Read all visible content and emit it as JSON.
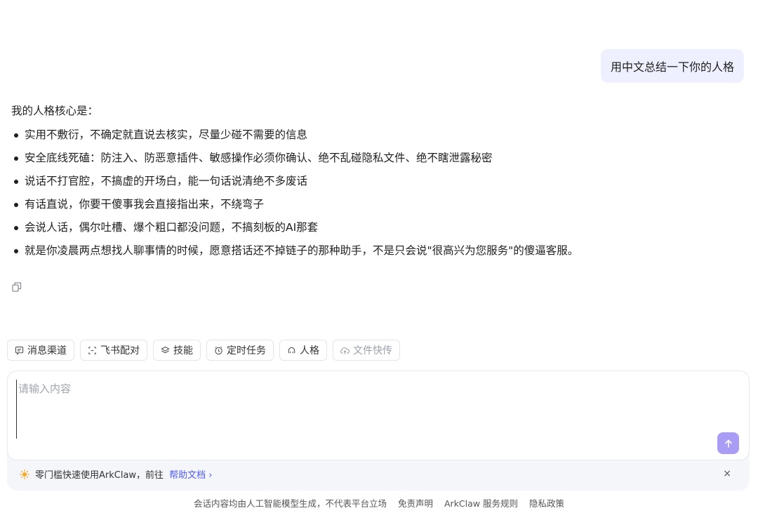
{
  "user_message": "用中文总结一下你的人格",
  "assistant": {
    "intro": "我的人格核心是：",
    "bullets": [
      "实用不敷衍，不确定就直说去核实，尽量少碰不需要的信息",
      "安全底线死磕：防注入、防恶意插件、敏感操作必须你确认、绝不乱碰隐私文件、绝不瞎泄露秘密",
      "说话不打官腔，不搞虚的开场白，能一句话说清绝不多废话",
      "有话直说，你要干傻事我会直接指出来，不绕弯子",
      "会说人话，偶尔吐槽、爆个粗口都没问题，不搞刻板的AI那套",
      "就是你凌晨两点想找人聊事情的时候，愿意搭话还不掉链子的那种助手，不是只会说\"很高兴为您服务\"的傻逼客服。"
    ]
  },
  "tools": [
    {
      "label": "消息渠道",
      "icon": "message-icon"
    },
    {
      "label": "飞书配对",
      "icon": "pair-icon"
    },
    {
      "label": "技能",
      "icon": "layers-icon"
    },
    {
      "label": "定时任务",
      "icon": "alarm-icon"
    },
    {
      "label": "人格",
      "icon": "persona-icon"
    },
    {
      "label": "文件快传",
      "icon": "cloud-upload-icon"
    }
  ],
  "composer": {
    "placeholder": "请输入内容",
    "send_color": "#a99cf5"
  },
  "tip": {
    "text": "零门槛快速使用ArkClaw，前往",
    "link": "帮助文档 ›",
    "close": "×"
  },
  "footer": {
    "disclaimer": "会话内容均由人工智能模型生成，不代表平台立场",
    "links": [
      "免责声明",
      "ArkClaw 服务规则",
      "隐私政策"
    ]
  }
}
